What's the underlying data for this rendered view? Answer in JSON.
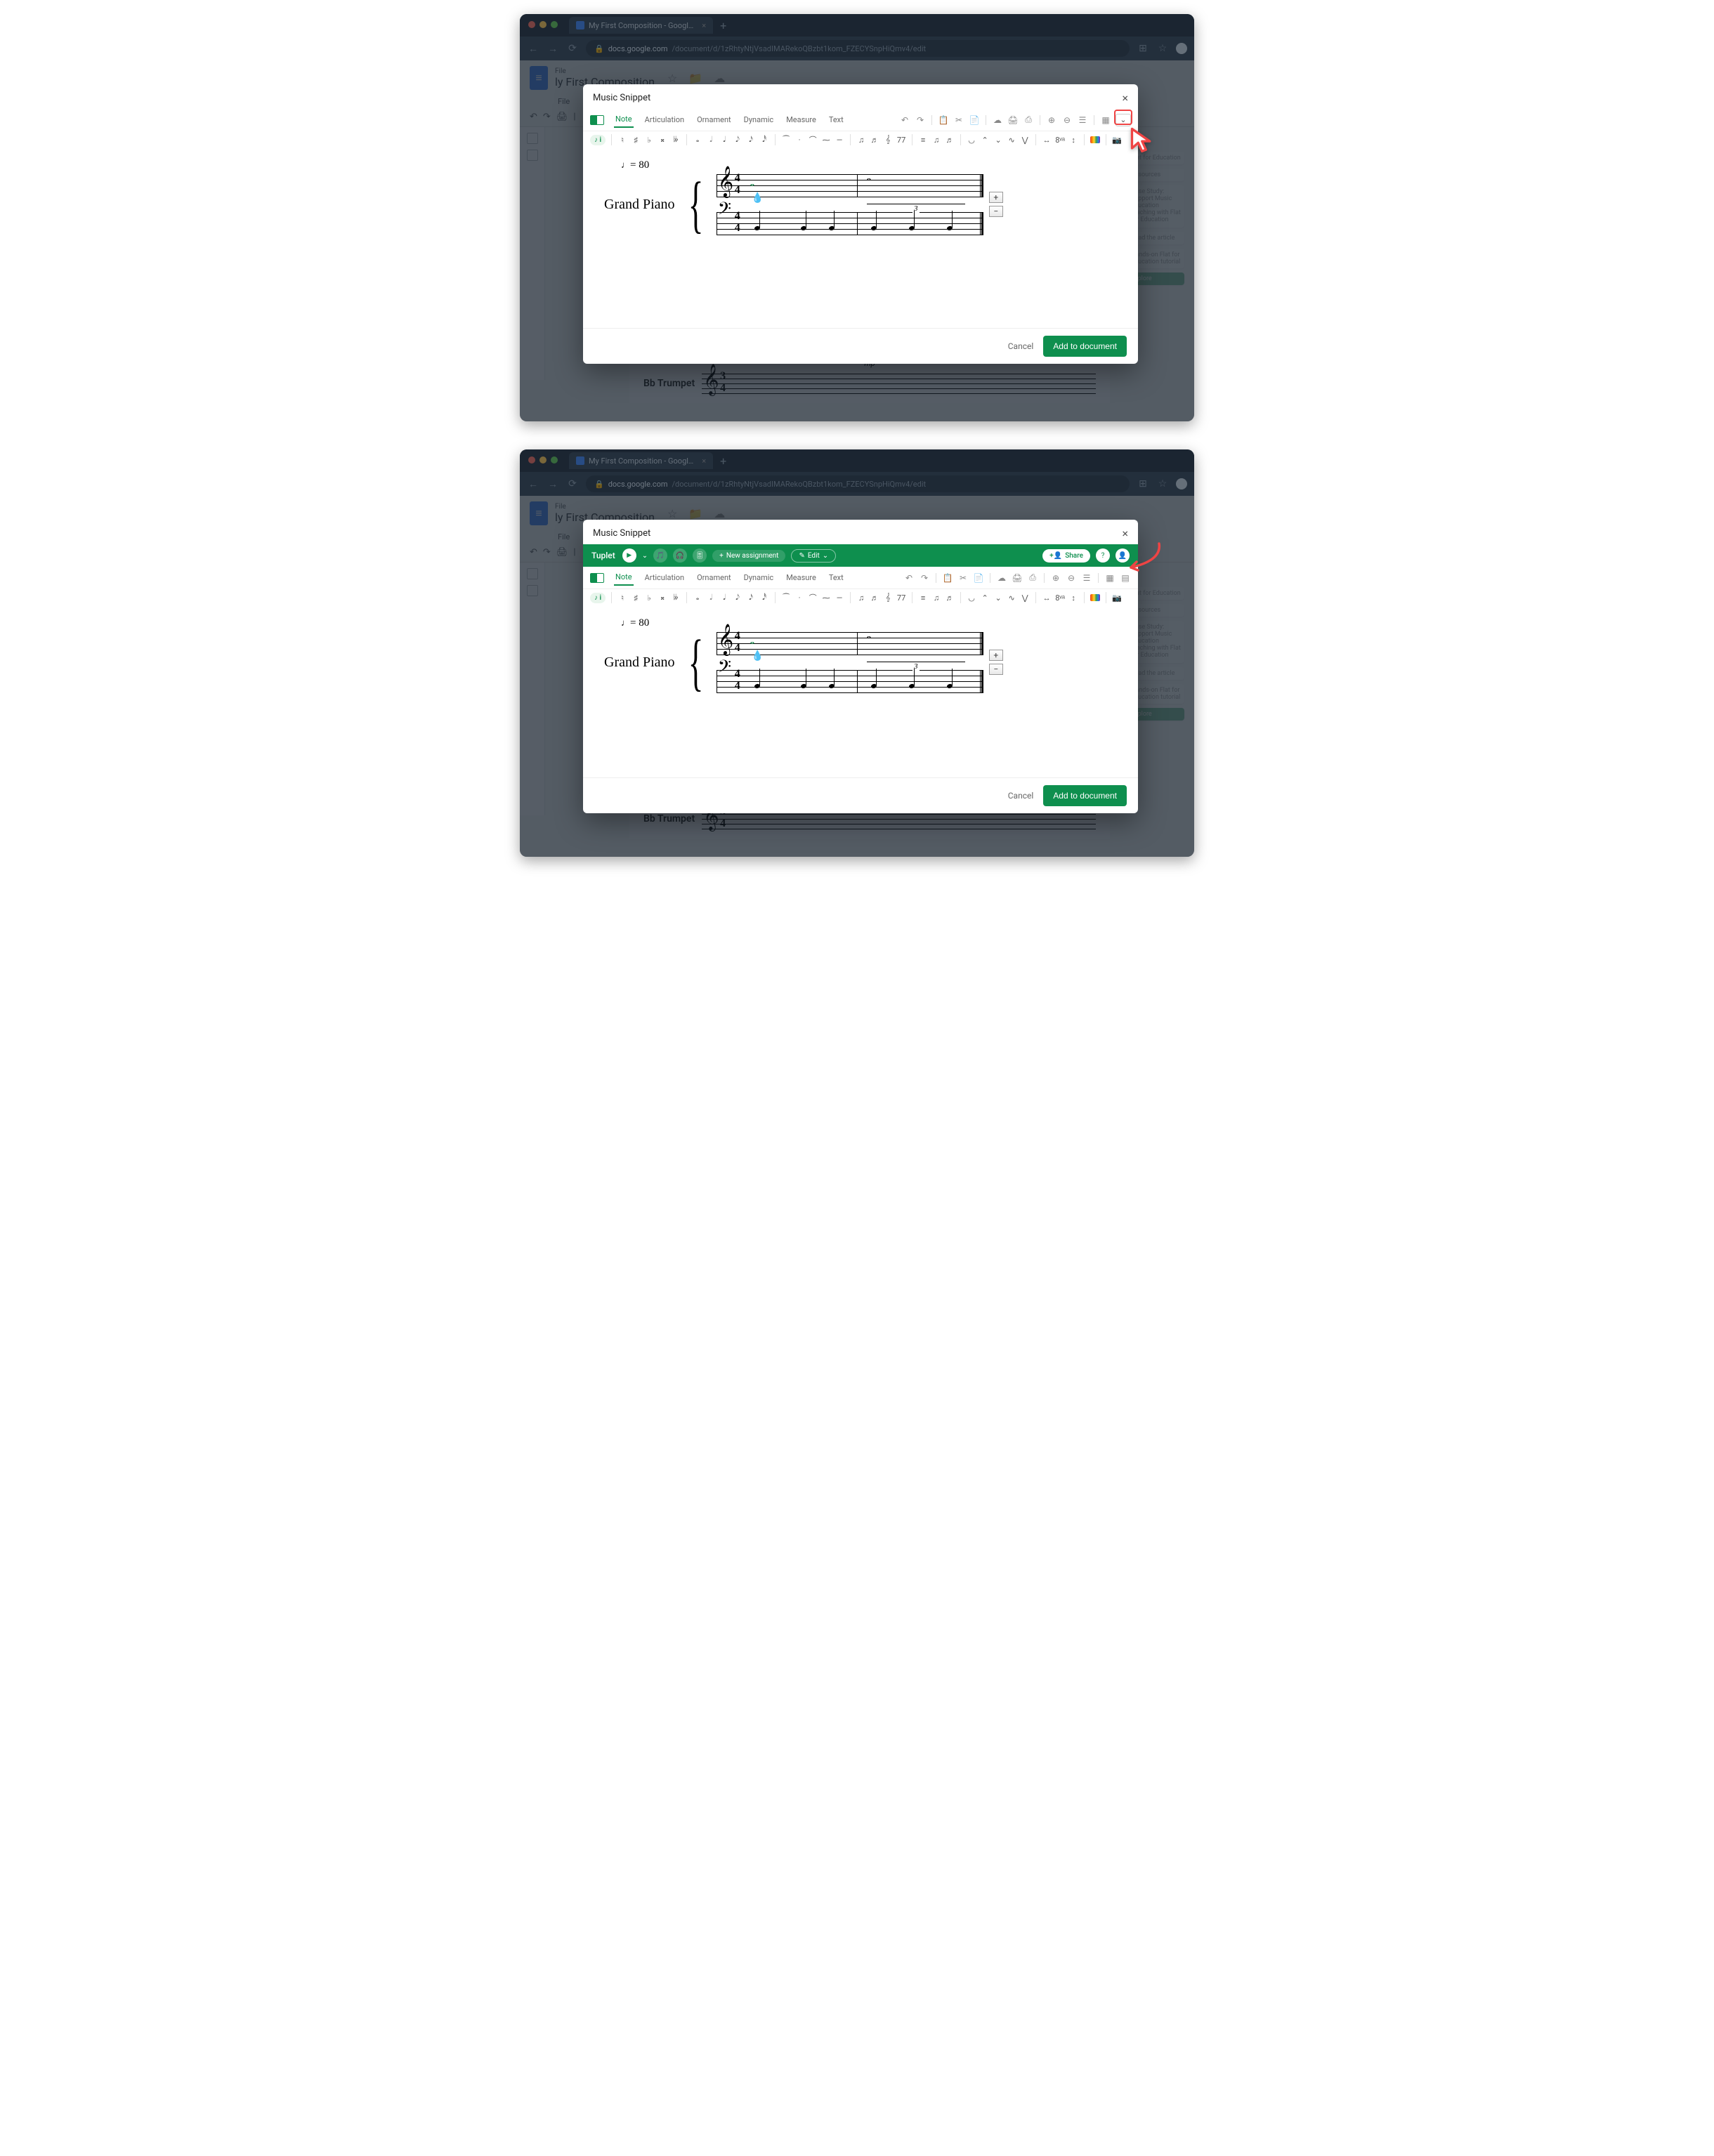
{
  "browser": {
    "tab_title": "My First Composition - Googl…",
    "url_host": "docs.google.com",
    "url_path": "/document/d/1zRhtyNtjVsadIMARekoQBzbt1kom_FZECYSnpHiQmv4/edit"
  },
  "docs": {
    "title": "ly First Composition",
    "file_menu": "File",
    "bg_instrument": "Bb Trumpet",
    "bg_dynamic": "mp"
  },
  "modal": {
    "title": "Music Snippet",
    "cancel": "Cancel",
    "add": "Add to document",
    "tabs": [
      "Note",
      "Articulation",
      "Ornament",
      "Dynamic",
      "Measure",
      "Text"
    ],
    "notepill": "♪ i",
    "greenbar": {
      "title": "Tuplet",
      "new_assignment": "New assignment",
      "edit": "Edit",
      "share": "Share"
    }
  },
  "score": {
    "instrument": "Grand Piano",
    "tempo_note": "♩",
    "tempo_eq": "= 80",
    "timesig_top": "4",
    "timesig_bot": "4",
    "tuplet_num": "3",
    "zoom_plus": "+",
    "zoom_minus": "−"
  },
  "toolbar_glyphs": {
    "accidentals": [
      "♮",
      "♯",
      "♭",
      "𝄪",
      "𝄫"
    ],
    "durations": [
      "𝅝",
      "𝅗𝅥",
      "𝅘𝅥",
      "𝅘𝅥𝅮",
      "𝅘𝅥𝅯",
      "𝅘𝅥𝅰"
    ],
    "groupA": [
      "⁀",
      "·",
      "⌒",
      "⁓",
      "—"
    ],
    "groupB": [
      "♫",
      "♬",
      "𝄞",
      "77"
    ],
    "groupC": [
      "≡",
      "♫",
      "♬"
    ],
    "groupD": [
      "◡",
      "⌃",
      "⌄",
      "∿",
      "⋁"
    ],
    "groupE": [
      "↔",
      "8ᵛᵃ",
      "↕"
    ]
  },
  "sidepanel": {
    "a": "Flat for Education",
    "b": "Resources",
    "c": "Case Study: Support Music Education teaching with Flat for Education",
    "d": "Read the article",
    "e": "Hands-on Flat for Education tutorial",
    "f": "Explore"
  }
}
